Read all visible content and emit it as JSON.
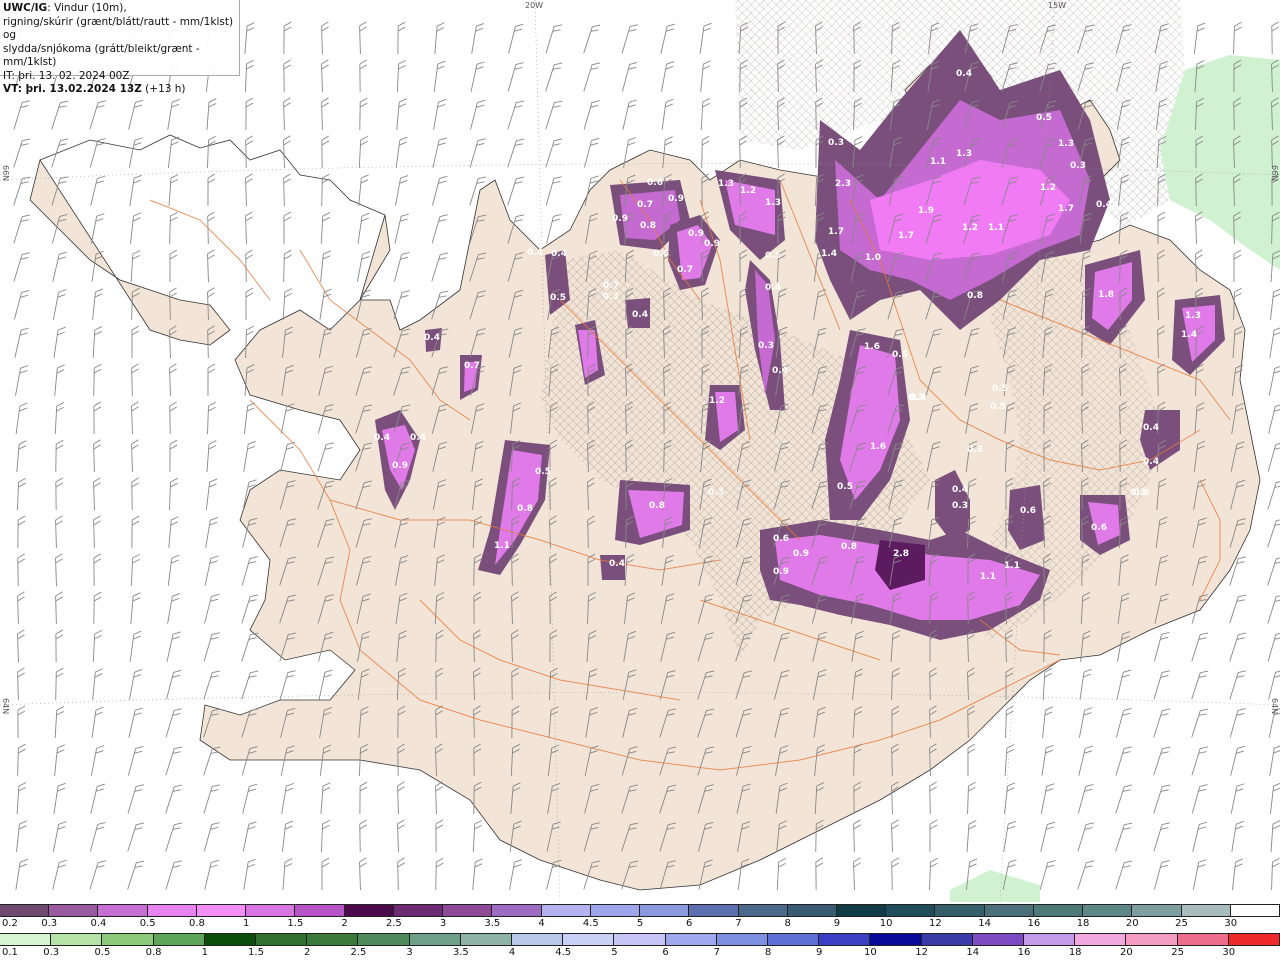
{
  "info": {
    "model": "UWC/IG",
    "line1": ": Vindur (10m),",
    "line2": "rigning/skúrir (grænt/blátt/rautt - mm/1klst) og",
    "line3": "slydda/snjókoma (grátt/bleikt/grænt - mm/1klst)",
    "it_label": "IT",
    "it_value": ": þri. 13. 02. 2024 00Z",
    "vt_label": "VT",
    "vt_value": ": þri. 13.02.2024 13Z",
    "vt_offset": "(+13 h)"
  },
  "grid_labels": {
    "top_20w": "20W",
    "top_15w": "15W",
    "left_66n": "66N",
    "left_64n": "64N",
    "right_66n": "66N",
    "right_64n": "64N"
  },
  "colors": {
    "land": "#f2e4d6",
    "sea": "#ffffff",
    "roads": "#e87a3c",
    "snow_light": "#7a4f7c",
    "snow_mid": "#c46ad0",
    "snow_heavy": "#f07bf5",
    "rain_light": "#c8f0c8"
  },
  "map_values": [
    {
      "v": "0.6"
    },
    {
      "v": "0.7"
    },
    {
      "v": "0.9"
    },
    {
      "v": "0.8"
    },
    {
      "v": "0.9"
    },
    {
      "v": "0.6"
    },
    {
      "v": "1.3"
    },
    {
      "v": "1.2"
    },
    {
      "v": "1.3"
    },
    {
      "v": "0.9"
    },
    {
      "v": "0.9"
    },
    {
      "v": "0.7"
    },
    {
      "v": "0.4"
    },
    {
      "v": "0.7"
    },
    {
      "v": "0.5"
    },
    {
      "v": "0.4"
    },
    {
      "v": "2.3"
    },
    {
      "v": "1.7"
    },
    {
      "v": "1.4"
    },
    {
      "v": "1.0"
    },
    {
      "v": "1.7"
    },
    {
      "v": "1.9"
    },
    {
      "v": "1.1"
    },
    {
      "v": "1.3"
    },
    {
      "v": "1.2"
    },
    {
      "v": "1.1"
    },
    {
      "v": "1.3"
    },
    {
      "v": "1.2"
    },
    {
      "v": "1.7"
    },
    {
      "v": "0.8"
    },
    {
      "v": "1.8"
    },
    {
      "v": "1.3"
    },
    {
      "v": "1.4"
    },
    {
      "v": "0.4"
    },
    {
      "v": "0.5"
    },
    {
      "v": "0.3"
    },
    {
      "v": "0.4"
    },
    {
      "v": "0.3"
    },
    {
      "v": "0.4"
    },
    {
      "v": "0.5"
    },
    {
      "v": "0.3"
    },
    {
      "v": "0.3"
    },
    {
      "v": "1.6"
    },
    {
      "v": "0.5"
    },
    {
      "v": "0.3"
    },
    {
      "v": "0.5"
    },
    {
      "v": "0.5"
    },
    {
      "v": "1.2"
    },
    {
      "v": "0.4"
    },
    {
      "v": "0.4"
    },
    {
      "v": "0.7"
    },
    {
      "v": "0.4"
    },
    {
      "v": "0.9"
    },
    {
      "v": "0.5"
    },
    {
      "v": "0.8"
    },
    {
      "v": "1.1"
    },
    {
      "v": "0.8"
    },
    {
      "v": "0.4"
    },
    {
      "v": "0.3"
    },
    {
      "v": "1.6"
    },
    {
      "v": "0.5"
    },
    {
      "v": "0.3"
    },
    {
      "v": "0.4"
    },
    {
      "v": "0.3"
    },
    {
      "v": "0.6"
    },
    {
      "v": "0.4"
    },
    {
      "v": "0.4"
    },
    {
      "v": "0.6"
    },
    {
      "v": "0.6"
    },
    {
      "v": "0.9"
    },
    {
      "v": "0.8"
    },
    {
      "v": "0.9"
    },
    {
      "v": "2.8"
    },
    {
      "v": "1.1"
    },
    {
      "v": "1.1"
    },
    {
      "v": "0.6"
    },
    {
      "v": "0.3"
    },
    {
      "v": "0.4"
    },
    {
      "v": "0.3"
    },
    {
      "v": "0.4"
    },
    {
      "v": "0.3"
    }
  ],
  "legend": {
    "snow_labels": [
      "0.2",
      "0.3",
      "0.4",
      "0.5",
      "0.8",
      "1",
      "1.5",
      "2",
      "2.5",
      "3",
      "3.5",
      "4",
      "4.5",
      "5",
      "6",
      "7",
      "8",
      "9",
      "10",
      "12",
      "14",
      "16",
      "18",
      "20",
      "25",
      "30"
    ],
    "snow_colors": [
      "#6e4a6e",
      "#9a5aa0",
      "#c66fd3",
      "#e783ef",
      "#f58ff8",
      "#d775e3",
      "#b855c6",
      "#4a0a4c",
      "#6d2b74",
      "#8f4a97",
      "#9d6cc3",
      "#b3b3f0",
      "#9ea7ec",
      "#8b99de",
      "#5c6fae",
      "#4b6a8b",
      "#3a5c73",
      "#0f3c47",
      "#1f4d5a",
      "#355f6a",
      "#4b6f78",
      "#4d7978",
      "#5e8788",
      "#7e9ea0",
      "#a8bcbd",
      "#ffffff"
    ],
    "rain_labels": [
      "0.1",
      "0.3",
      "0.5",
      "0.8",
      "1",
      "1.5",
      "2",
      "2.5",
      "3",
      "3.5",
      "4",
      "4.5",
      "5",
      "6",
      "7",
      "8",
      "9",
      "10",
      "12",
      "14",
      "16",
      "18",
      "20",
      "25",
      "30"
    ],
    "rain_colors": [
      "#d7f5d2",
      "#b5e3a8",
      "#8ccb7c",
      "#5ea55a",
      "#0b4d0b",
      "#2f6f2f",
      "#3a7a3a",
      "#4e8a5c",
      "#6f9f86",
      "#8fb3a6",
      "#b7c8ea",
      "#c9d1f7",
      "#c5c6f6",
      "#9fa8ec",
      "#7f8fe2",
      "#5f6fd8",
      "#3a3fc4",
      "#0a0a9a",
      "#3b3aa9",
      "#7c4bc1",
      "#c39be8",
      "#f2a9e0",
      "#f39bc3",
      "#ef6d8c",
      "#ee2a2a"
    ]
  }
}
